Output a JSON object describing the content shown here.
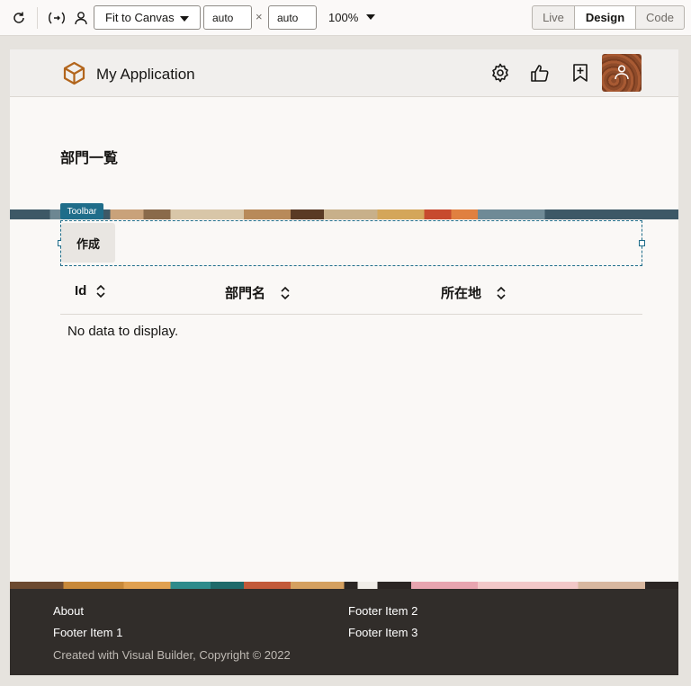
{
  "designer": {
    "fit_select": "Fit to Canvas",
    "width_value": "auto",
    "height_value": "auto",
    "times_sign": "×",
    "zoom": "100%",
    "modes": {
      "live": "Live",
      "design": "Design",
      "code": "Code"
    },
    "icons": [
      "refresh-icon",
      "variable-icon",
      "user-icon"
    ]
  },
  "app": {
    "title": "My Application",
    "header_icons": [
      "settings-icon",
      "thumbs-up-icon",
      "bookmark-add-icon",
      "avatar-icon"
    ]
  },
  "page": {
    "title": "部門一覧",
    "toolbar_badge": "Toolbar",
    "create_button": "作成",
    "table": {
      "columns": [
        "Id",
        "部門名",
        "所在地"
      ],
      "empty_text": "No data to display."
    }
  },
  "footer": {
    "left_links": [
      "About",
      "Footer Item 1"
    ],
    "right_links": [
      "Footer Item 2",
      "Footer Item 3"
    ],
    "copyright": "Created with Visual Builder, Copyright © 2022"
  },
  "colors": {
    "accent": "#1f6d8a",
    "footer_bg": "#312d2a",
    "logo": "#b2651c"
  }
}
